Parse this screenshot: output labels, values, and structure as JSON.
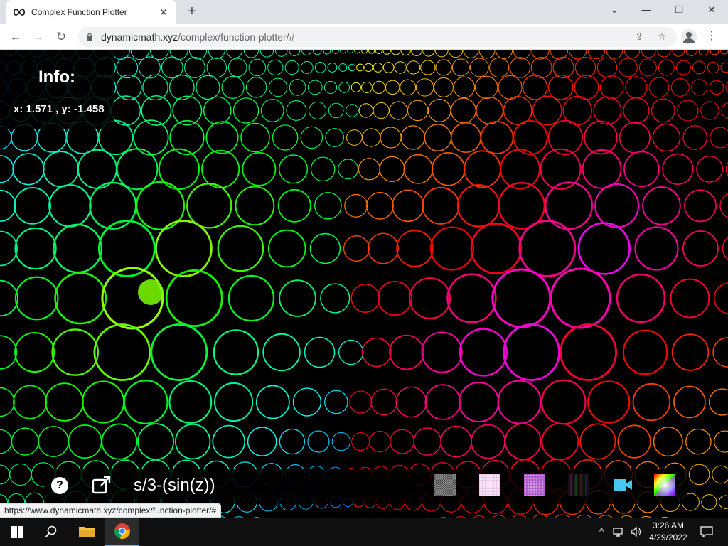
{
  "browser": {
    "tab_title": "Complex Function Plotter",
    "tab_close": "✕",
    "new_tab": "+",
    "url_domain": "dynamicmath.xyz",
    "url_path": "/complex/function-plotter/#",
    "status_url": "https://www.dynamicmath.xyz/complex/function-plotter/#",
    "window_controls": {
      "chevron": "⌄",
      "minimize": "—",
      "maximize": "❐",
      "close": "✕"
    }
  },
  "info": {
    "title": "Info:",
    "coords": "x: 1.571 , y: -1.458"
  },
  "controls": {
    "help_label": "?",
    "function_value": "s/3-(sin(z))",
    "textures": [
      "checker-gray",
      "grid-pink",
      "grid-purple",
      "stripes-dark"
    ]
  },
  "taskbar": {
    "time": "3:26 AM",
    "date": "4/29/2022"
  },
  "colors": {
    "left_center": "#7cff00",
    "right_center": "#ff22dd"
  }
}
